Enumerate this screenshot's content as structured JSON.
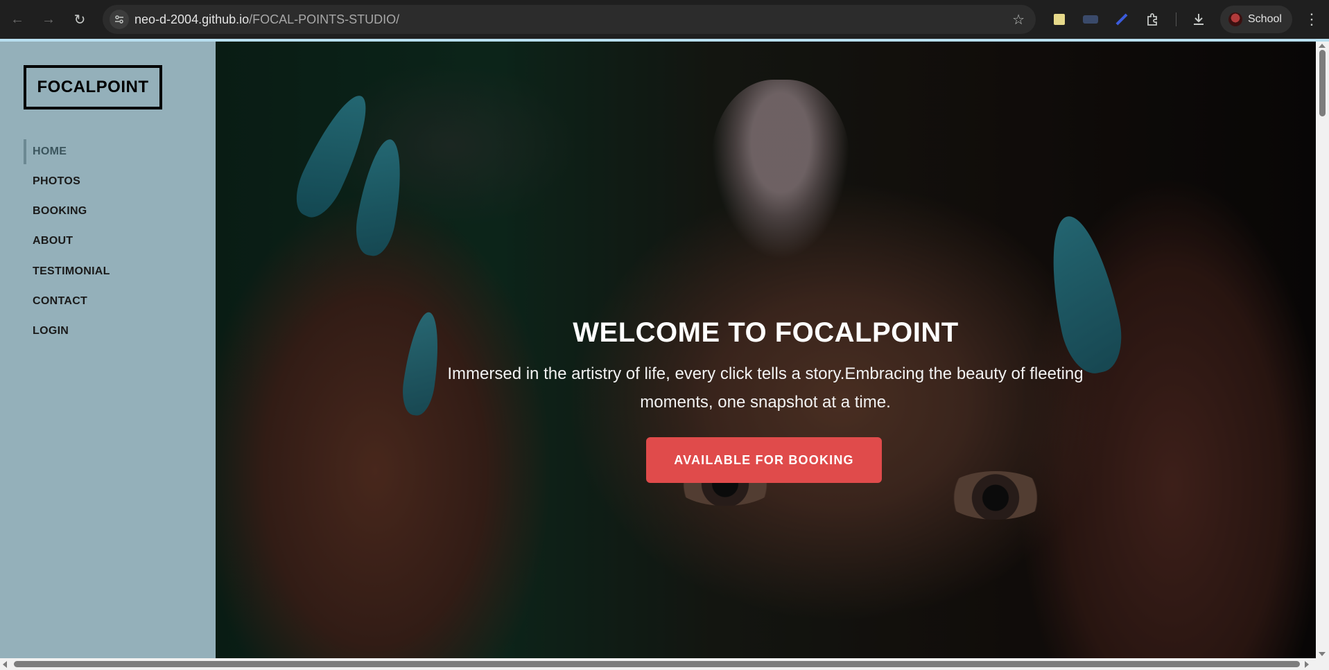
{
  "browser": {
    "url_host": "neo-d-2004.github.io",
    "url_path": "/FOCAL-POINTS-STUDIO/",
    "profile_label": "School",
    "icons": [
      "back-icon",
      "forward-icon",
      "reload-icon",
      "site-info-icon",
      "star-icon",
      "extension-note-icon",
      "extension-hat-icon",
      "extension-pen-icon",
      "extensions-puzzle-icon",
      "download-icon",
      "more-menu-icon"
    ]
  },
  "sidebar": {
    "logo": "FOCALPOINT",
    "items": [
      {
        "label": "HOME",
        "active": true
      },
      {
        "label": "PHOTOS"
      },
      {
        "label": "BOOKING"
      },
      {
        "label": "ABOUT"
      },
      {
        "label": "TESTIMONIAL"
      },
      {
        "label": "CONTACT"
      },
      {
        "label": "LOGIN"
      }
    ]
  },
  "hero": {
    "title": "WELCOME TO FOCALPOINT",
    "text": "Immersed in the artistry of life, every click tells a story.Embracing the beauty of fleeting moments, one snapshot at a time.",
    "cta": "AVAILABLE FOR BOOKING"
  },
  "colors": {
    "sidebar_bg": "#94b0ba",
    "cta_bg": "#e04b4b",
    "active_indicator": "#6c8993"
  }
}
